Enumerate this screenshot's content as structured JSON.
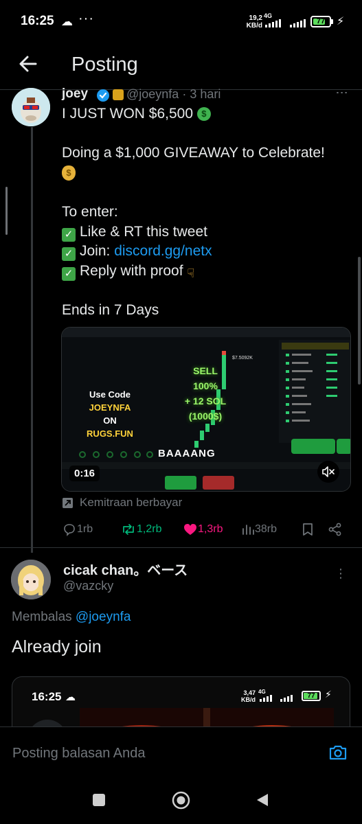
{
  "status_bar": {
    "time": "16:25",
    "overflow": "···",
    "net_speed": "19,2",
    "net_unit": "KB/d",
    "network": "4G",
    "battery": "77",
    "battery_level": 0.77
  },
  "header": {
    "title": "Posting"
  },
  "tweet": {
    "author_name": "joey",
    "handle": "@joeynfa",
    "time": "3 hari",
    "body": {
      "line1": "I JUST WON $6,500",
      "line2": "Doing a $1,000 GIVEAWAY to Celebrate!",
      "line3": "To enter:",
      "line4": "Like & RT this tweet",
      "line5_prefix": "Join: ",
      "line5_link": "discord.gg/netx",
      "line6": "Reply with proof",
      "line7": "Ends in 7 Days"
    },
    "media": {
      "promo_line1": "Use Code",
      "promo_line2": "JOEYNFA",
      "promo_line3": "ON",
      "promo_line4": "RUGS.FUN",
      "sell_line1": "SELL",
      "sell_line2": "100%",
      "sell_line3": "+ 12 SOL",
      "sell_line4": "(1000$)",
      "price_tag": "$7.5092K",
      "overlay_text": "BAAAANG",
      "duration": "0:16"
    },
    "sponsored_label": "Kemitraan berbayar",
    "actions": {
      "replies": "1rb",
      "reposts": "1,2rb",
      "likes": "1,3rb",
      "views": "38rb"
    }
  },
  "reply": {
    "author_name": "cicak chan。ベース",
    "handle": "@vazcky",
    "replying_prefix": "Membalas ",
    "replying_to": "@joeynfa",
    "text": "Already join",
    "nested_screenshot": {
      "time": "16:25",
      "net_speed": "3,47",
      "net_unit": "KB/d",
      "network": "4G",
      "battery": "77"
    }
  },
  "composer": {
    "placeholder": "Posting balasan Anda"
  },
  "colors": {
    "accent": "#1d9bf0",
    "like": "#f91880",
    "repost": "#00ba7c",
    "muted": "#71767b"
  }
}
